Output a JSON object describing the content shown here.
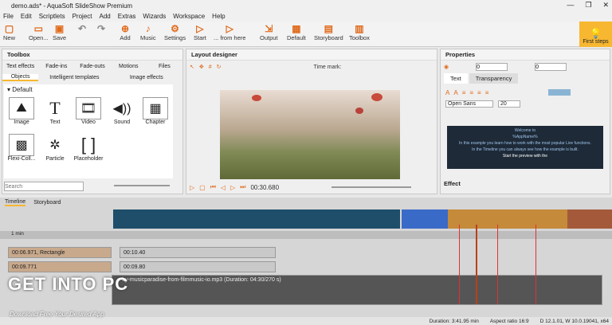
{
  "window": {
    "title": "demo.ads* - AquaSoft SlideShow Premium",
    "btn_min": "—",
    "btn_max": "❐",
    "btn_close": "✕"
  },
  "menu": [
    "File",
    "Edit",
    "Scriptlets",
    "Project",
    "Add",
    "Extras",
    "Wizards",
    "Workspace",
    "Help"
  ],
  "toolbar": {
    "new": "New",
    "open": "Open...",
    "save": "Save",
    "add": "Add",
    "music": "Music",
    "settings": "Settings",
    "start": "Start",
    "from_here": "... from here",
    "output": "Output",
    "default": "Default",
    "storyboard": "Storyboard",
    "toolbox": "Toolbox",
    "first_steps": "First steps"
  },
  "toolbox": {
    "title": "Toolbox",
    "tabs1": [
      "Text effects",
      "Fade-ins",
      "Fade-outs",
      "Motions",
      "Files"
    ],
    "tabs2": [
      "Objects",
      "Intelligent templates",
      "Image effects"
    ],
    "group": "Default",
    "items": [
      {
        "label": "Image",
        "icon": "image-icon"
      },
      {
        "label": "Text",
        "icon": "text-icon"
      },
      {
        "label": "Video",
        "icon": "video-icon"
      },
      {
        "label": "Sound",
        "icon": "sound-icon"
      },
      {
        "label": "Chapter",
        "icon": "chapter-icon"
      },
      {
        "label": "Flexi-Coll...",
        "icon": "collage-icon"
      },
      {
        "label": "Particle",
        "icon": "particle-icon"
      },
      {
        "label": "Placeholder",
        "icon": "placeholder-icon"
      }
    ],
    "search_placeholder": "Search"
  },
  "layout": {
    "title": "Layout designer",
    "time_mark_label": "Time mark:",
    "time": "00:30.680"
  },
  "properties": {
    "title": "Properties",
    "field1": "0",
    "field2": "0",
    "tabs": [
      "Text",
      "Transparency"
    ],
    "font": "Open Sans",
    "size": "20",
    "preview_lines": [
      "Welcome to",
      "%AppName%",
      "In this example you learn how to work with the most popular Live functions.",
      "In the Timeline you can always see how the example is built.",
      "Start the preview with the",
      "Play button (play)"
    ],
    "effect_label": "Effect"
  },
  "timeline": {
    "tabs": [
      "Timeline",
      "Storyboard"
    ],
    "ruler_label": "1 min",
    "track1": "00:06.971, Rectangle",
    "track2": "00:10.40",
    "track3": "00:09.80",
    "track4": "00:09.771",
    "audio": "...-by-musicparadise-from-filmmusic-io.mp3 (Duration: 04:30/270 s)"
  },
  "status": {
    "duration": "Duration: 3:41.95 min",
    "aspect": "Aspect ratio 16:9",
    "version": "D 12.1.01, W 10.0.19041, x64"
  },
  "watermark": {
    "main": "GET INTO PC",
    "sub": "Download Free Your Desired App"
  }
}
